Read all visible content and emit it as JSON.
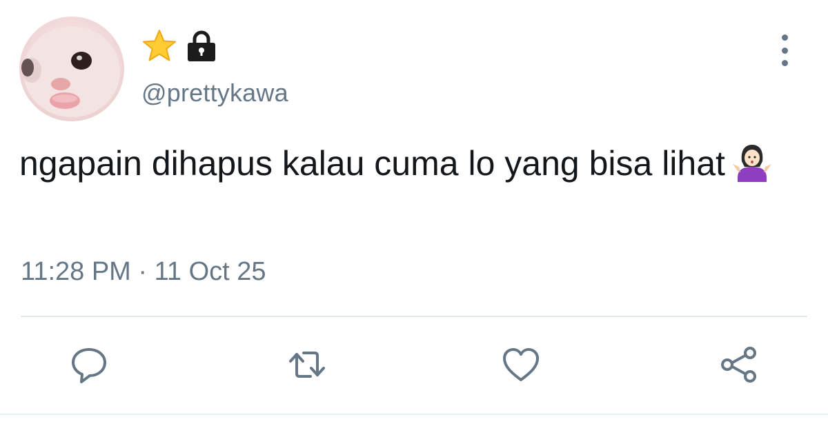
{
  "author": {
    "handle": "@prettykawa",
    "badges": [
      "star-icon",
      "lock-icon"
    ],
    "avatar": "cat-face-avatar"
  },
  "tweet": {
    "text": "ngapain dihapus kalau cuma lo yang bisa lihat",
    "emoji": "woman-shrugging-icon",
    "timestamp": "11:28 PM · 11 Oct 25"
  },
  "actions": [
    "reply-icon",
    "retweet-icon",
    "like-icon",
    "share-icon"
  ],
  "colors": {
    "text": "#14171a",
    "secondary": "#657786",
    "divider": "#e1e8ed",
    "star": "#ffcc33",
    "emoji_shirt": "#8e3fbf"
  }
}
